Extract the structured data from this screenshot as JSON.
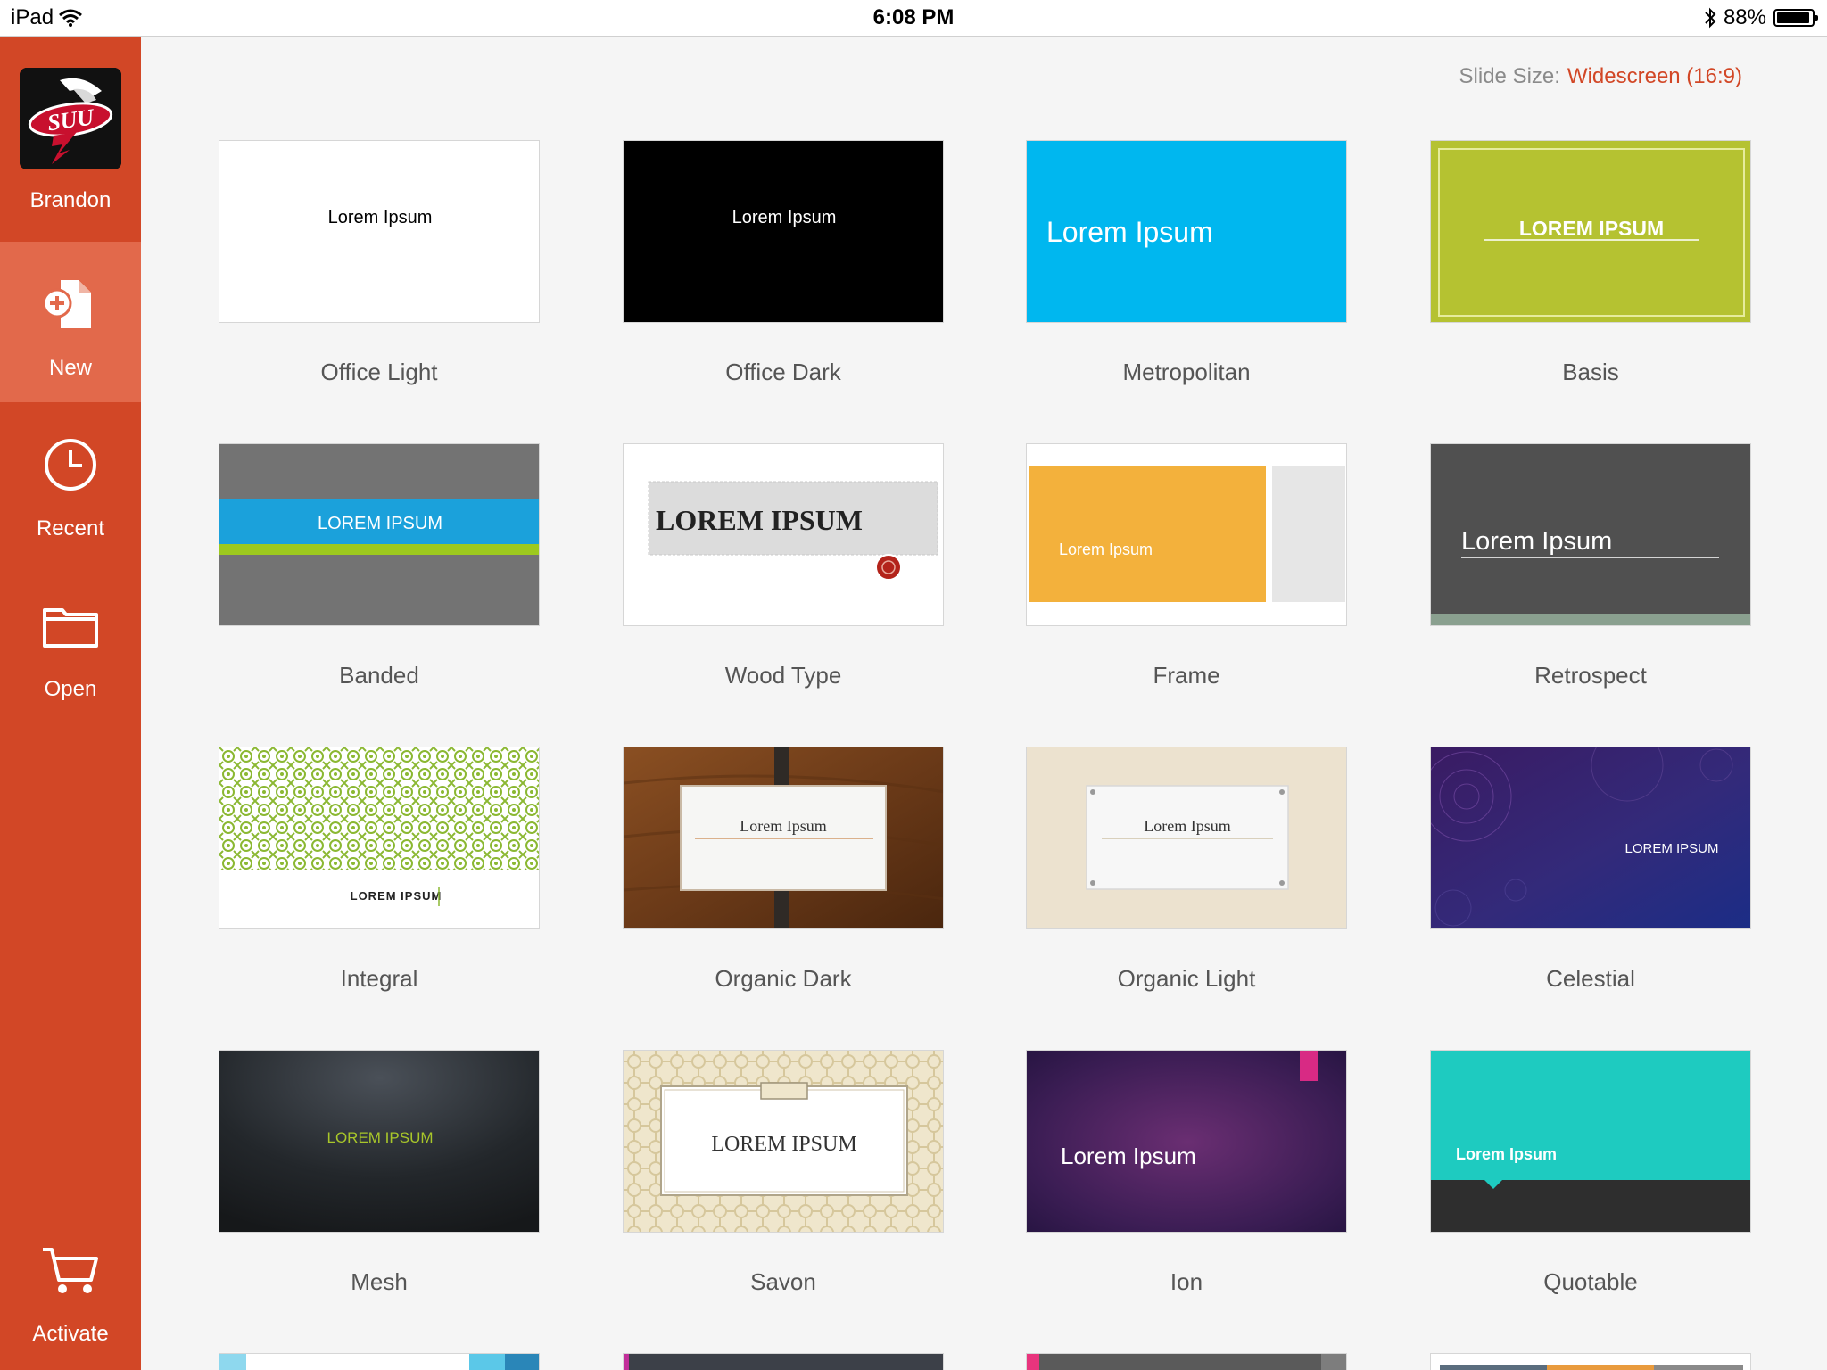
{
  "status": {
    "device": "iPad",
    "time": "6:08 PM",
    "battery": "88%"
  },
  "account": {
    "name": "Brandon",
    "logo_text": "SUU"
  },
  "nav": {
    "new": "New",
    "recent": "Recent",
    "open": "Open",
    "activate": "Activate"
  },
  "slide_size": {
    "label": "Slide Size:",
    "value": "Widescreen (16:9)"
  },
  "themes": [
    {
      "name": "Office Light",
      "preview": "Lorem Ipsum"
    },
    {
      "name": "Office Dark",
      "preview": "Lorem Ipsum"
    },
    {
      "name": "Metropolitan",
      "preview": "Lorem Ipsum"
    },
    {
      "name": "Basis",
      "preview": "LOREM IPSUM"
    },
    {
      "name": "Banded",
      "preview": "LOREM IPSUM"
    },
    {
      "name": "Wood Type",
      "preview": "LOREM IPSUM"
    },
    {
      "name": "Frame",
      "preview": "Lorem Ipsum"
    },
    {
      "name": "Retrospect",
      "preview": "Lorem Ipsum"
    },
    {
      "name": "Integral",
      "preview": "LOREM IPSUM"
    },
    {
      "name": "Organic Dark",
      "preview": "Lorem Ipsum"
    },
    {
      "name": "Organic Light",
      "preview": "Lorem Ipsum"
    },
    {
      "name": "Celestial",
      "preview": "LOREM IPSUM"
    },
    {
      "name": "Mesh",
      "preview": "LOREM IPSUM"
    },
    {
      "name": "Savon",
      "preview": "LOREM IPSUM"
    },
    {
      "name": "Ion",
      "preview": "Lorem Ipsum"
    },
    {
      "name": "Quotable",
      "preview": "Lorem Ipsum"
    }
  ],
  "colors": {
    "accent": "#d24726",
    "selected_nav": "#e2694b"
  }
}
